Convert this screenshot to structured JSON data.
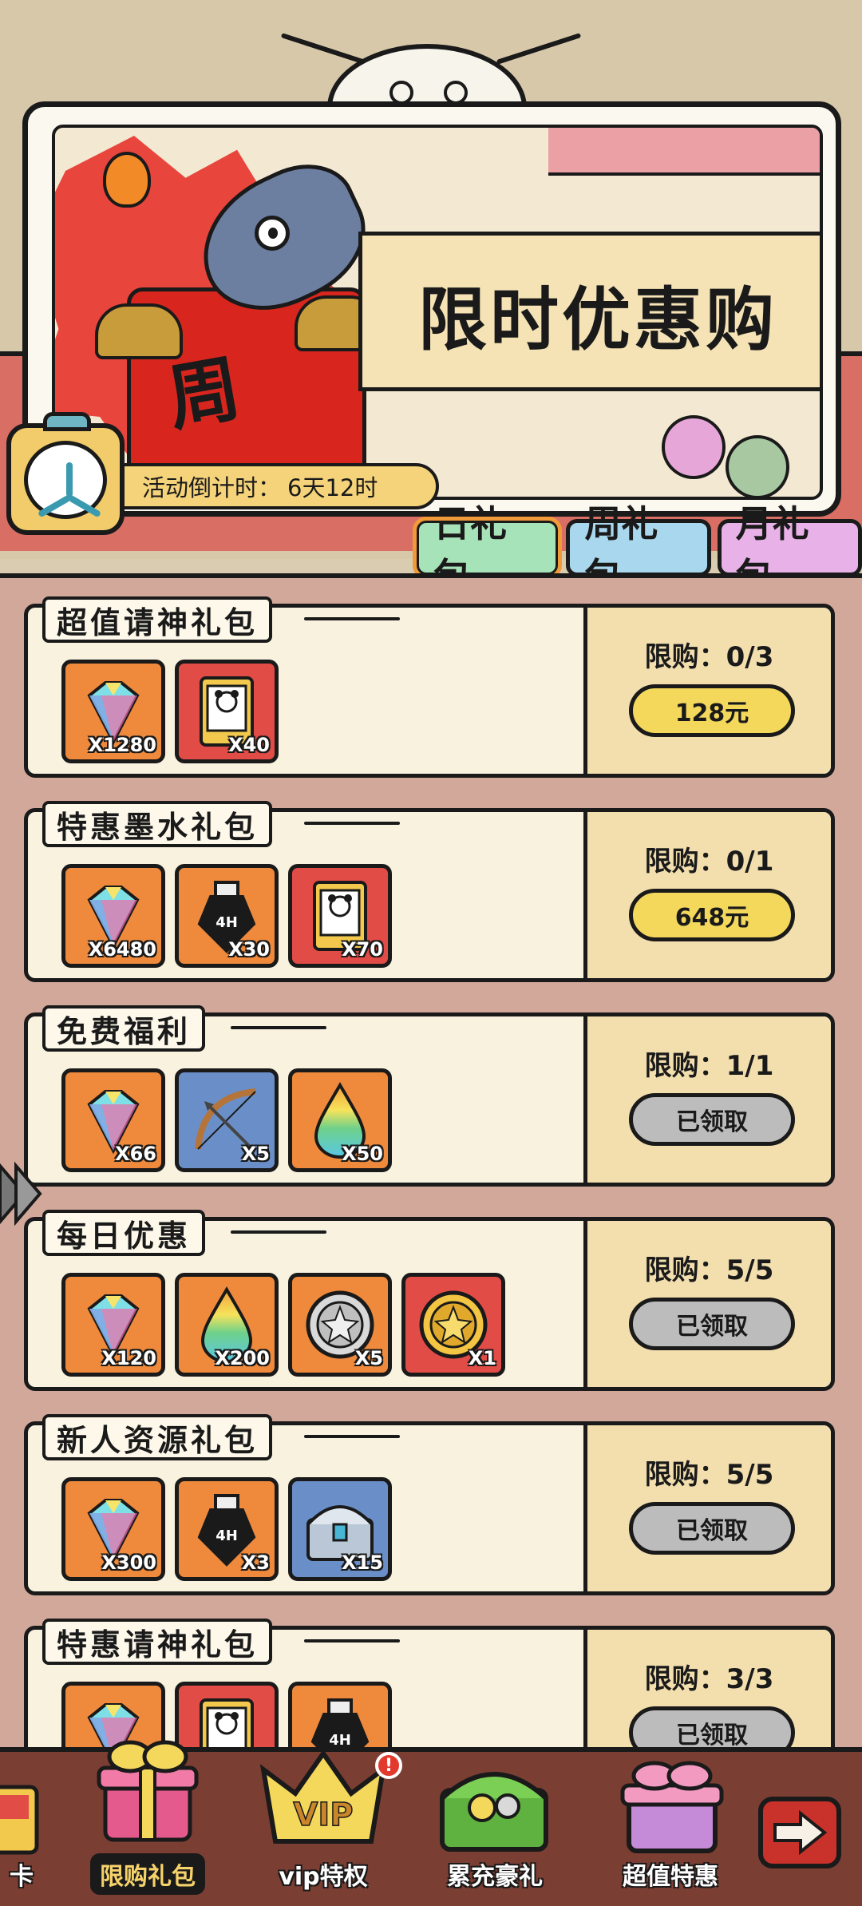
{
  "banner": {
    "title": "限时优惠购",
    "robe_char": "周",
    "countdown_label": "活动倒计时：",
    "countdown_value": "6天12时"
  },
  "tabs": [
    {
      "label": "日礼包",
      "active": true
    },
    {
      "label": "周礼包",
      "active": false
    },
    {
      "label": "月礼包",
      "active": false
    }
  ],
  "packs": [
    {
      "name": "超值请神礼包",
      "limit": "限购：0/3",
      "button": "128元",
      "button_state": "buy",
      "items": [
        {
          "icon": "diamond-icon",
          "qty": "X1280",
          "bg": "orange"
        },
        {
          "icon": "summon-card-icon",
          "qty": "X40",
          "bg": "red"
        }
      ]
    },
    {
      "name": "特惠墨水礼包",
      "limit": "限购：0/1",
      "button": "648元",
      "button_state": "buy",
      "items": [
        {
          "icon": "diamond-icon",
          "qty": "X6480",
          "bg": "orange"
        },
        {
          "icon": "ink-bottle-icon",
          "qty": "X30",
          "bg": "orange"
        },
        {
          "icon": "summon-card-icon",
          "qty": "X70",
          "bg": "red"
        }
      ]
    },
    {
      "name": "免费福利",
      "limit": "限购：1/1",
      "button": "已领取",
      "button_state": "claimed",
      "items": [
        {
          "icon": "diamond-icon",
          "qty": "X66",
          "bg": "orange"
        },
        {
          "icon": "bow-icon",
          "qty": "X5",
          "bg": "blue"
        },
        {
          "icon": "rainbow-drop-icon",
          "qty": "X50",
          "bg": "orange"
        }
      ]
    },
    {
      "name": "每日优惠",
      "limit": "限购：5/5",
      "button": "已领取",
      "button_state": "claimed",
      "items": [
        {
          "icon": "diamond-icon",
          "qty": "X120",
          "bg": "orange"
        },
        {
          "icon": "rainbow-drop-icon",
          "qty": "X200",
          "bg": "orange"
        },
        {
          "icon": "silver-coin-icon",
          "qty": "X5",
          "bg": "orange"
        },
        {
          "icon": "gold-coin-icon",
          "qty": "X1",
          "bg": "red"
        }
      ]
    },
    {
      "name": "新人资源礼包",
      "limit": "限购：5/5",
      "button": "已领取",
      "button_state": "claimed",
      "items": [
        {
          "icon": "diamond-icon",
          "qty": "X300",
          "bg": "orange"
        },
        {
          "icon": "ink-bottle-icon",
          "qty": "X3",
          "bg": "orange"
        },
        {
          "icon": "treasure-chest-icon",
          "qty": "X15",
          "bg": "blue"
        }
      ]
    },
    {
      "name": "特惠请神礼包",
      "limit": "限购：3/3",
      "button": "已领取",
      "button_state": "claimed",
      "items": [
        {
          "icon": "diamond-icon",
          "qty": "",
          "bg": "orange"
        },
        {
          "icon": "summon-card-icon",
          "qty": "",
          "bg": "red"
        },
        {
          "icon": "ink-bottle-icon",
          "qty": "",
          "bg": "orange"
        }
      ]
    }
  ],
  "bottom_nav": [
    {
      "label": "卡",
      "icon": "card-icon"
    },
    {
      "label": "限购礼包",
      "icon": "gift-box-icon",
      "active": true
    },
    {
      "label": "vip特权",
      "icon": "vip-crown-icon",
      "badge": "!"
    },
    {
      "label": "累充豪礼",
      "icon": "treasure-chest-icon"
    },
    {
      "label": "超值特惠",
      "icon": "pink-gift-icon"
    }
  ],
  "colors": {
    "gold_button": "#f4d85c",
    "claimed_button": "#bcbcbc",
    "tab_day": "#a7e3b8",
    "tab_week": "#a9d8ee",
    "tab_month": "#e8b2e8",
    "list_bg": "#d2a89a",
    "nav_bg": "#7b3e33"
  }
}
